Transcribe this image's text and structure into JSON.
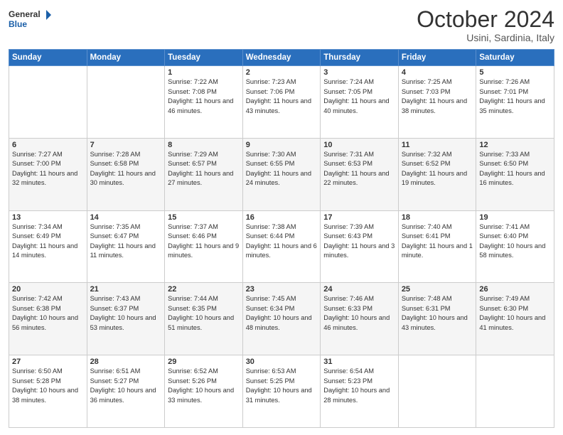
{
  "header": {
    "logo_line1": "General",
    "logo_line2": "Blue",
    "month": "October 2024",
    "location": "Usini, Sardinia, Italy"
  },
  "weekdays": [
    "Sunday",
    "Monday",
    "Tuesday",
    "Wednesday",
    "Thursday",
    "Friday",
    "Saturday"
  ],
  "weeks": [
    [
      {
        "day": "",
        "info": ""
      },
      {
        "day": "",
        "info": ""
      },
      {
        "day": "1",
        "info": "Sunrise: 7:22 AM\nSunset: 7:08 PM\nDaylight: 11 hours and 46 minutes."
      },
      {
        "day": "2",
        "info": "Sunrise: 7:23 AM\nSunset: 7:06 PM\nDaylight: 11 hours and 43 minutes."
      },
      {
        "day": "3",
        "info": "Sunrise: 7:24 AM\nSunset: 7:05 PM\nDaylight: 11 hours and 40 minutes."
      },
      {
        "day": "4",
        "info": "Sunrise: 7:25 AM\nSunset: 7:03 PM\nDaylight: 11 hours and 38 minutes."
      },
      {
        "day": "5",
        "info": "Sunrise: 7:26 AM\nSunset: 7:01 PM\nDaylight: 11 hours and 35 minutes."
      }
    ],
    [
      {
        "day": "6",
        "info": "Sunrise: 7:27 AM\nSunset: 7:00 PM\nDaylight: 11 hours and 32 minutes."
      },
      {
        "day": "7",
        "info": "Sunrise: 7:28 AM\nSunset: 6:58 PM\nDaylight: 11 hours and 30 minutes."
      },
      {
        "day": "8",
        "info": "Sunrise: 7:29 AM\nSunset: 6:57 PM\nDaylight: 11 hours and 27 minutes."
      },
      {
        "day": "9",
        "info": "Sunrise: 7:30 AM\nSunset: 6:55 PM\nDaylight: 11 hours and 24 minutes."
      },
      {
        "day": "10",
        "info": "Sunrise: 7:31 AM\nSunset: 6:53 PM\nDaylight: 11 hours and 22 minutes."
      },
      {
        "day": "11",
        "info": "Sunrise: 7:32 AM\nSunset: 6:52 PM\nDaylight: 11 hours and 19 minutes."
      },
      {
        "day": "12",
        "info": "Sunrise: 7:33 AM\nSunset: 6:50 PM\nDaylight: 11 hours and 16 minutes."
      }
    ],
    [
      {
        "day": "13",
        "info": "Sunrise: 7:34 AM\nSunset: 6:49 PM\nDaylight: 11 hours and 14 minutes."
      },
      {
        "day": "14",
        "info": "Sunrise: 7:35 AM\nSunset: 6:47 PM\nDaylight: 11 hours and 11 minutes."
      },
      {
        "day": "15",
        "info": "Sunrise: 7:37 AM\nSunset: 6:46 PM\nDaylight: 11 hours and 9 minutes."
      },
      {
        "day": "16",
        "info": "Sunrise: 7:38 AM\nSunset: 6:44 PM\nDaylight: 11 hours and 6 minutes."
      },
      {
        "day": "17",
        "info": "Sunrise: 7:39 AM\nSunset: 6:43 PM\nDaylight: 11 hours and 3 minutes."
      },
      {
        "day": "18",
        "info": "Sunrise: 7:40 AM\nSunset: 6:41 PM\nDaylight: 11 hours and 1 minute."
      },
      {
        "day": "19",
        "info": "Sunrise: 7:41 AM\nSunset: 6:40 PM\nDaylight: 10 hours and 58 minutes."
      }
    ],
    [
      {
        "day": "20",
        "info": "Sunrise: 7:42 AM\nSunset: 6:38 PM\nDaylight: 10 hours and 56 minutes."
      },
      {
        "day": "21",
        "info": "Sunrise: 7:43 AM\nSunset: 6:37 PM\nDaylight: 10 hours and 53 minutes."
      },
      {
        "day": "22",
        "info": "Sunrise: 7:44 AM\nSunset: 6:35 PM\nDaylight: 10 hours and 51 minutes."
      },
      {
        "day": "23",
        "info": "Sunrise: 7:45 AM\nSunset: 6:34 PM\nDaylight: 10 hours and 48 minutes."
      },
      {
        "day": "24",
        "info": "Sunrise: 7:46 AM\nSunset: 6:33 PM\nDaylight: 10 hours and 46 minutes."
      },
      {
        "day": "25",
        "info": "Sunrise: 7:48 AM\nSunset: 6:31 PM\nDaylight: 10 hours and 43 minutes."
      },
      {
        "day": "26",
        "info": "Sunrise: 7:49 AM\nSunset: 6:30 PM\nDaylight: 10 hours and 41 minutes."
      }
    ],
    [
      {
        "day": "27",
        "info": "Sunrise: 6:50 AM\nSunset: 5:28 PM\nDaylight: 10 hours and 38 minutes."
      },
      {
        "day": "28",
        "info": "Sunrise: 6:51 AM\nSunset: 5:27 PM\nDaylight: 10 hours and 36 minutes."
      },
      {
        "day": "29",
        "info": "Sunrise: 6:52 AM\nSunset: 5:26 PM\nDaylight: 10 hours and 33 minutes."
      },
      {
        "day": "30",
        "info": "Sunrise: 6:53 AM\nSunset: 5:25 PM\nDaylight: 10 hours and 31 minutes."
      },
      {
        "day": "31",
        "info": "Sunrise: 6:54 AM\nSunset: 5:23 PM\nDaylight: 10 hours and 28 minutes."
      },
      {
        "day": "",
        "info": ""
      },
      {
        "day": "",
        "info": ""
      }
    ]
  ]
}
